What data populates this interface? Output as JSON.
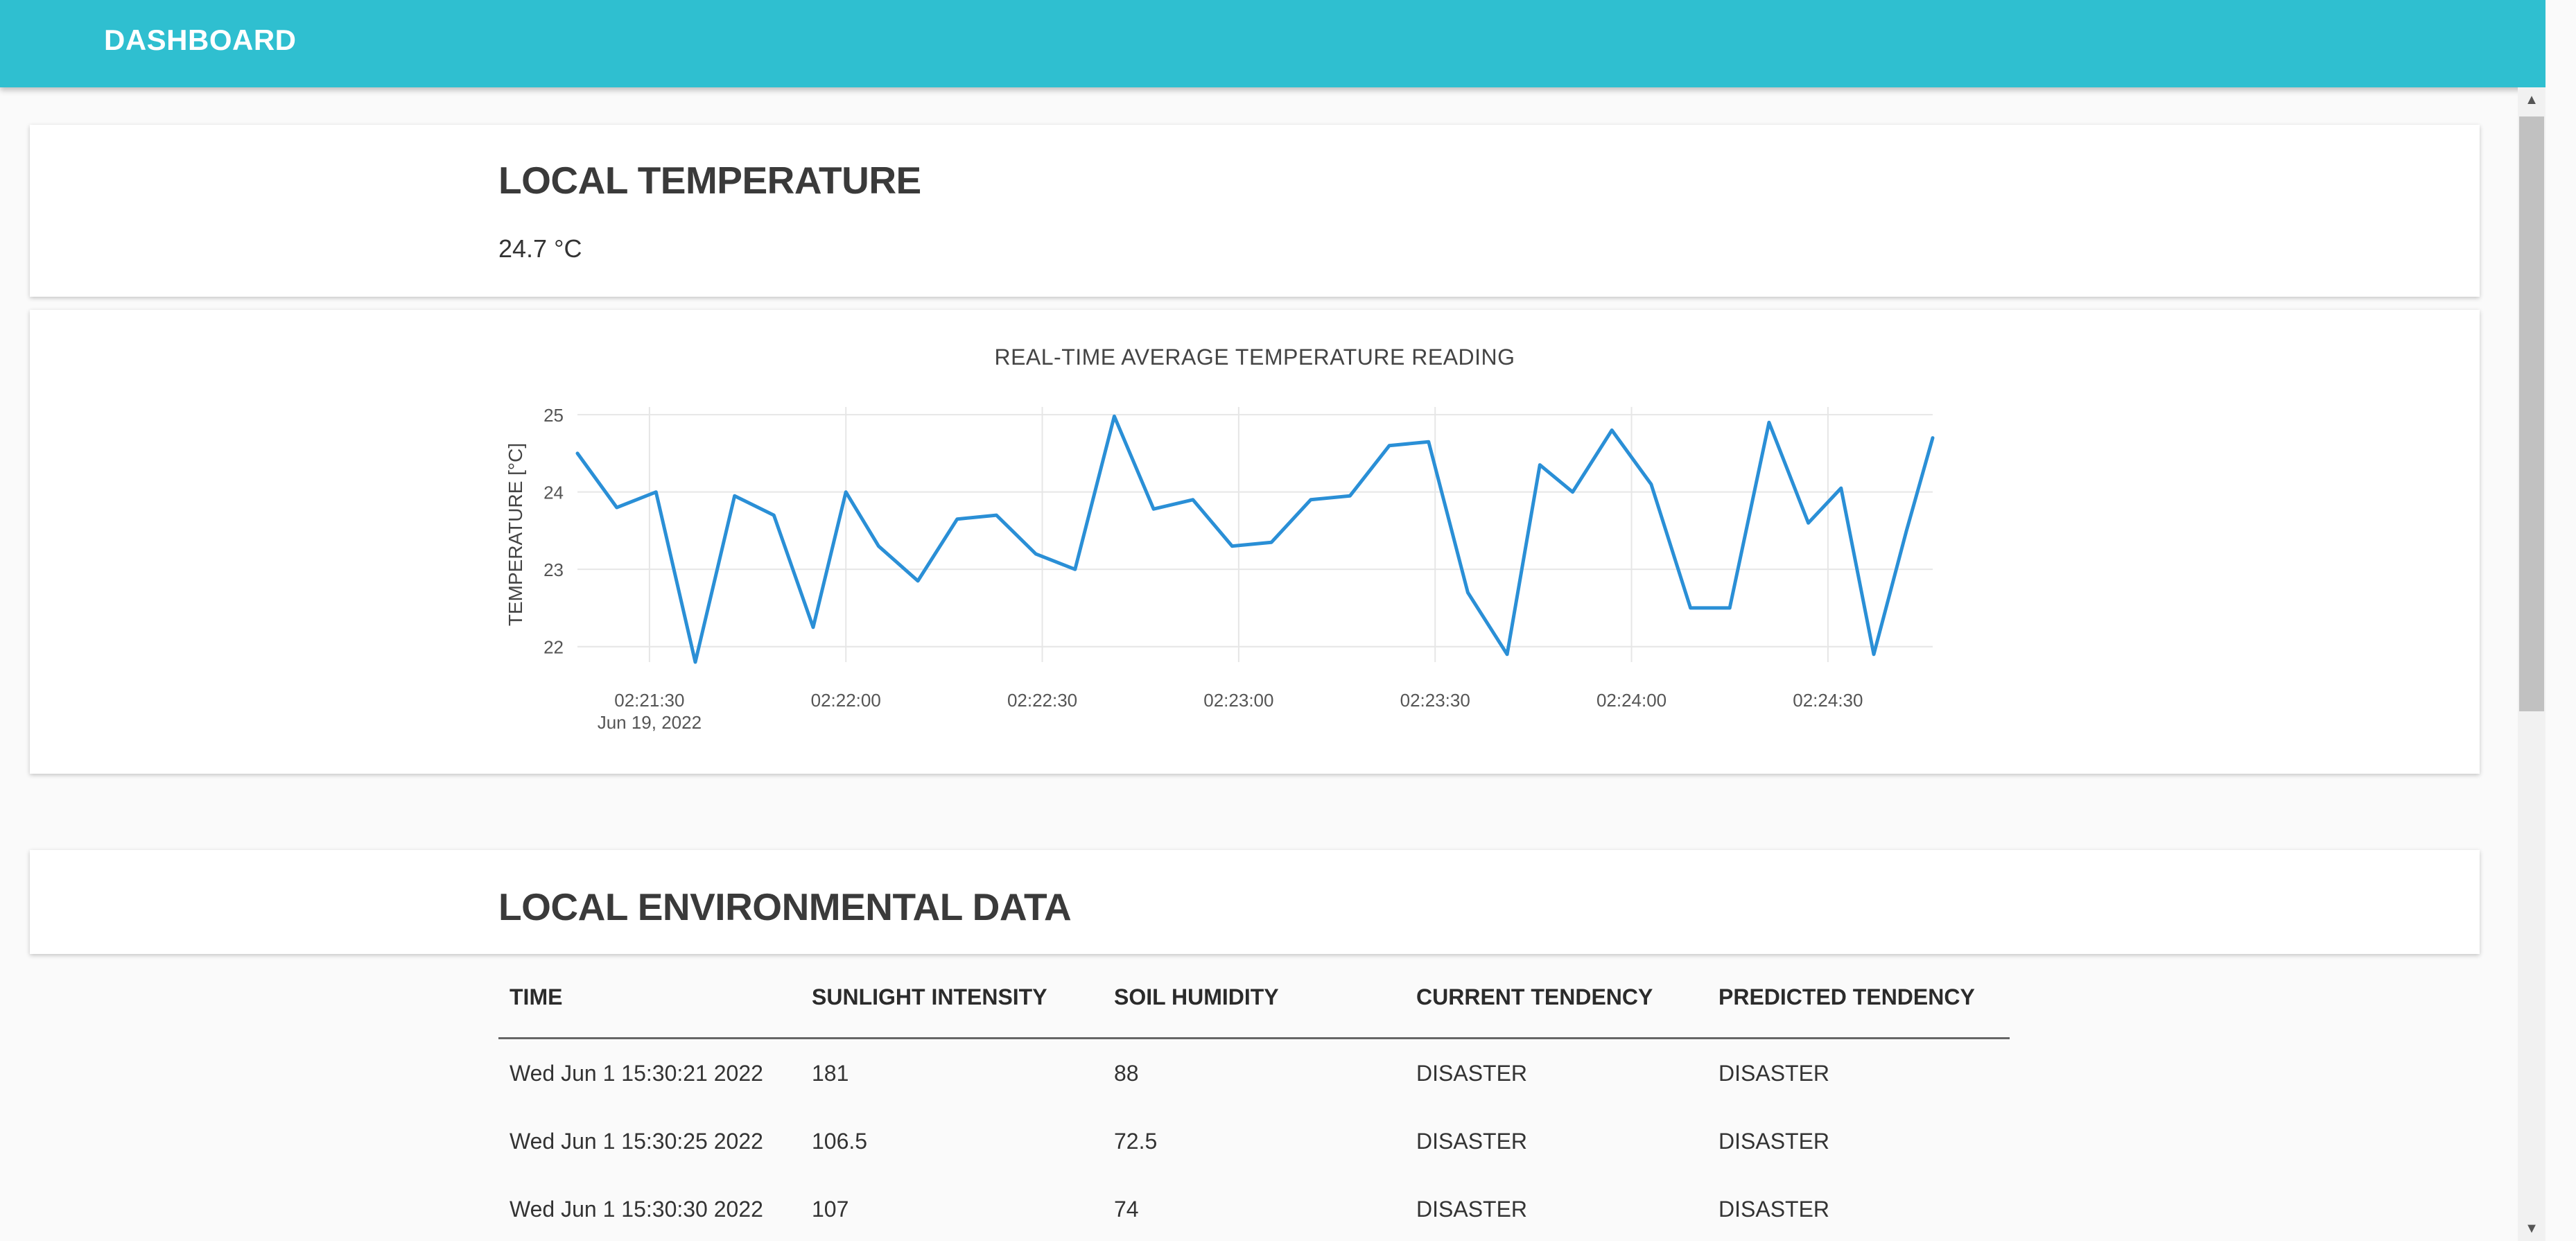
{
  "header": {
    "title": "DASHBOARD"
  },
  "temperature_card": {
    "title": "LOCAL TEMPERATURE",
    "value": "24.7 °C"
  },
  "chart_data": {
    "type": "line",
    "title": "REAL-TIME AVERAGE TEMPERATURE READING",
    "xlabel": "",
    "ylabel": "TEMPERATURE [°C]",
    "x_ticks": [
      "02:21:30",
      "02:22:00",
      "02:22:30",
      "02:23:00",
      "02:23:30",
      "02:24:00",
      "02:24:30"
    ],
    "x_tick_date": "Jun 19, 2022",
    "x_range": [
      "02:21:19",
      "02:24:46"
    ],
    "ylim": [
      21.8,
      25.1
    ],
    "y_ticks": [
      22,
      23,
      24,
      25
    ],
    "grid": true,
    "line_color": "#2a8fd6",
    "series": [
      {
        "x": [
          "02:21:19",
          "02:21:25",
          "02:21:31",
          "02:21:37",
          "02:21:43",
          "02:21:49",
          "02:21:55",
          "02:22:00",
          "02:22:05",
          "02:22:11",
          "02:22:17",
          "02:22:23",
          "02:22:29",
          "02:22:35",
          "02:22:41",
          "02:22:47",
          "02:22:53",
          "02:22:59",
          "02:23:05",
          "02:23:11",
          "02:23:17",
          "02:23:23",
          "02:23:29",
          "02:23:35",
          "02:23:41",
          "02:23:46",
          "02:23:51",
          "02:23:57",
          "02:24:03",
          "02:24:09",
          "02:24:15",
          "02:24:21",
          "02:24:27",
          "02:24:32",
          "02:24:37",
          "02:24:42",
          "02:24:46"
        ],
        "y": [
          24.5,
          23.8,
          24.0,
          21.8,
          23.95,
          23.7,
          22.25,
          24.0,
          23.3,
          22.85,
          23.65,
          23.7,
          23.2,
          23.0,
          24.98,
          23.78,
          23.9,
          23.3,
          23.35,
          23.9,
          23.95,
          24.6,
          24.65,
          22.7,
          21.9,
          24.35,
          24.0,
          24.8,
          24.1,
          22.5,
          22.5,
          24.9,
          23.6,
          24.05,
          21.9,
          23.5,
          24.7
        ]
      }
    ]
  },
  "environment_card": {
    "title": "LOCAL ENVIRONMENTAL DATA"
  },
  "table": {
    "columns": [
      "TIME",
      "SUNLIGHT INTENSITY",
      "SOIL HUMIDITY",
      "CURRENT TENDENCY",
      "PREDICTED TENDENCY"
    ],
    "rows": [
      [
        "Wed Jun  1 15:30:21 2022",
        "181",
        "88",
        "DISASTER",
        "DISASTER"
      ],
      [
        "Wed Jun  1 15:30:25 2022",
        "106.5",
        "72.5",
        "DISASTER",
        "DISASTER"
      ],
      [
        "Wed Jun  1 15:30:30 2022",
        "107",
        "74",
        "DISASTER",
        "DISASTER"
      ]
    ]
  },
  "icons": {
    "scroll_up": "scroll-up-arrow-icon",
    "scroll_down": "scroll-down-arrow-icon"
  },
  "colors": {
    "header": "#2fbfd0",
    "line": "#2a8fd6"
  }
}
